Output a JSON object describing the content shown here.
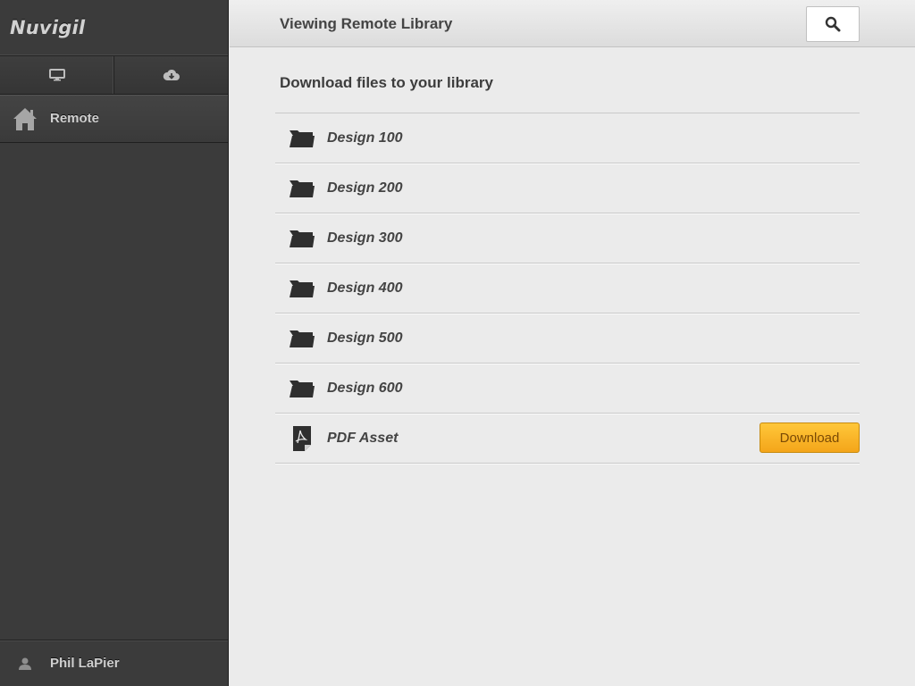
{
  "app": {
    "title": "Nuvigil"
  },
  "sidebar": {
    "segments": [
      {
        "icon": "desktop-icon"
      },
      {
        "icon": "cloud-download-icon"
      }
    ],
    "nav": {
      "label": "Remote",
      "icon": "home-icon"
    },
    "user": {
      "name": "Phil LaPier",
      "icon": "person-icon"
    }
  },
  "header": {
    "title": "Viewing Remote Library",
    "search_icon": "search-icon"
  },
  "main": {
    "section_title": "Download files to your library",
    "items": [
      {
        "label": "Design 100",
        "type": "folder"
      },
      {
        "label": "Design 200",
        "type": "folder"
      },
      {
        "label": "Design 300",
        "type": "folder"
      },
      {
        "label": "Design 400",
        "type": "folder"
      },
      {
        "label": "Design 500",
        "type": "folder"
      },
      {
        "label": "Design 600",
        "type": "folder"
      },
      {
        "label": "PDF Asset",
        "type": "pdf",
        "action": "Download"
      }
    ]
  },
  "colors": {
    "sidebar": "#3b3b3b",
    "accent": "#f7b02a",
    "content_bg": "#ebebeb"
  }
}
